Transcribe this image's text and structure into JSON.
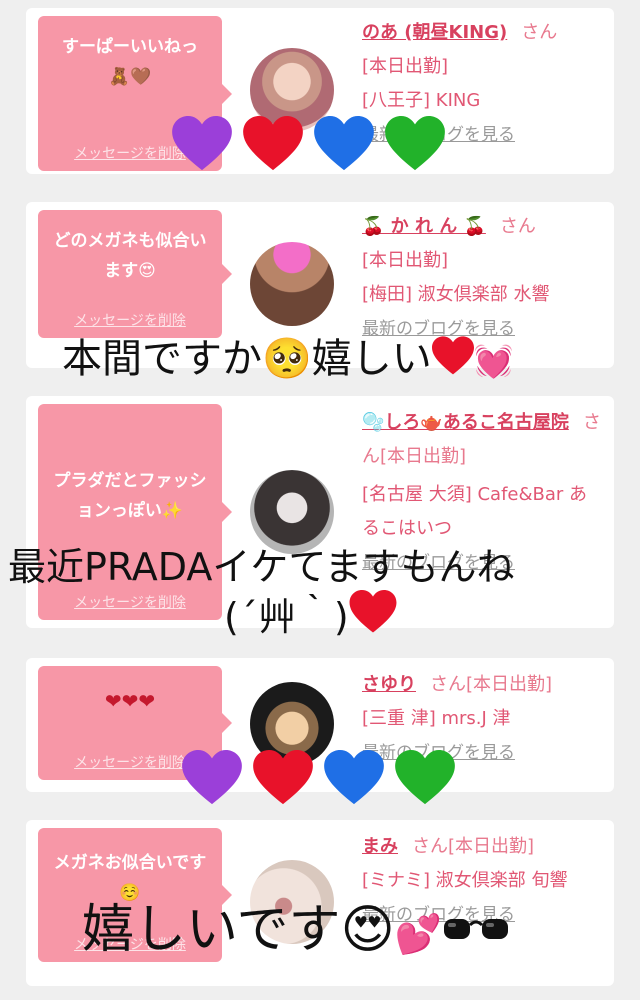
{
  "cards": [
    {
      "message": "すーぱーいいねっ",
      "message_emoji": "🧸🤎",
      "delete_label": "メッセージを削除",
      "name": "のあ (朝昼KING)",
      "honorific": "さん",
      "status": "[本日出勤]",
      "shop": "[八王子] KING",
      "blog_link": "最新のブログを見る"
    },
    {
      "message": "どのメガネも似合います😍",
      "delete_label": "メッセージを削除",
      "name": "🍒 か れ ん 🍒",
      "honorific": "さん",
      "status": "[本日出勤]",
      "shop": "[梅田] 淑女倶楽部 水響",
      "blog_link": "最新のブログを見る"
    },
    {
      "message": "プラダだとファッションっぽい✨",
      "delete_label": "メッセージを削除",
      "name": "🫧しろ🫖あるこ名古屋院",
      "honorific": "さん[本日出勤]",
      "shop": "[名古屋 大須] Cafe&Bar あるこはいつ",
      "blog_link": "最新のブログを見る"
    },
    {
      "message": "❤❤❤",
      "delete_label": "メッセージを削除",
      "name": "さゆり",
      "honorific": "さん[本日出勤]",
      "shop": "[三重 津] mrs.J 津",
      "blog_link": "最新のブログを見る"
    },
    {
      "message": "メガネお似合いです☺️",
      "delete_label": "メッセージを削除",
      "name": "まみ",
      "honorific": "さん[本日出勤]",
      "shop": "[ミナミ] 淑女倶楽部 旬響",
      "blog_link": "最新のブログを見る"
    }
  ],
  "overlays": {
    "text1": "本間ですか🥺嬉しい",
    "text2": "最近PRADAイケてますもんね",
    "text3": "(´艸｀)",
    "text4": "嬉しいです😍"
  },
  "colors": {
    "bubble": "#f797a7",
    "name": "#d8415f",
    "heart_purple": "#9b3fd9",
    "heart_red": "#e8122a",
    "heart_blue": "#1f6fe6",
    "heart_green": "#22b22a"
  }
}
